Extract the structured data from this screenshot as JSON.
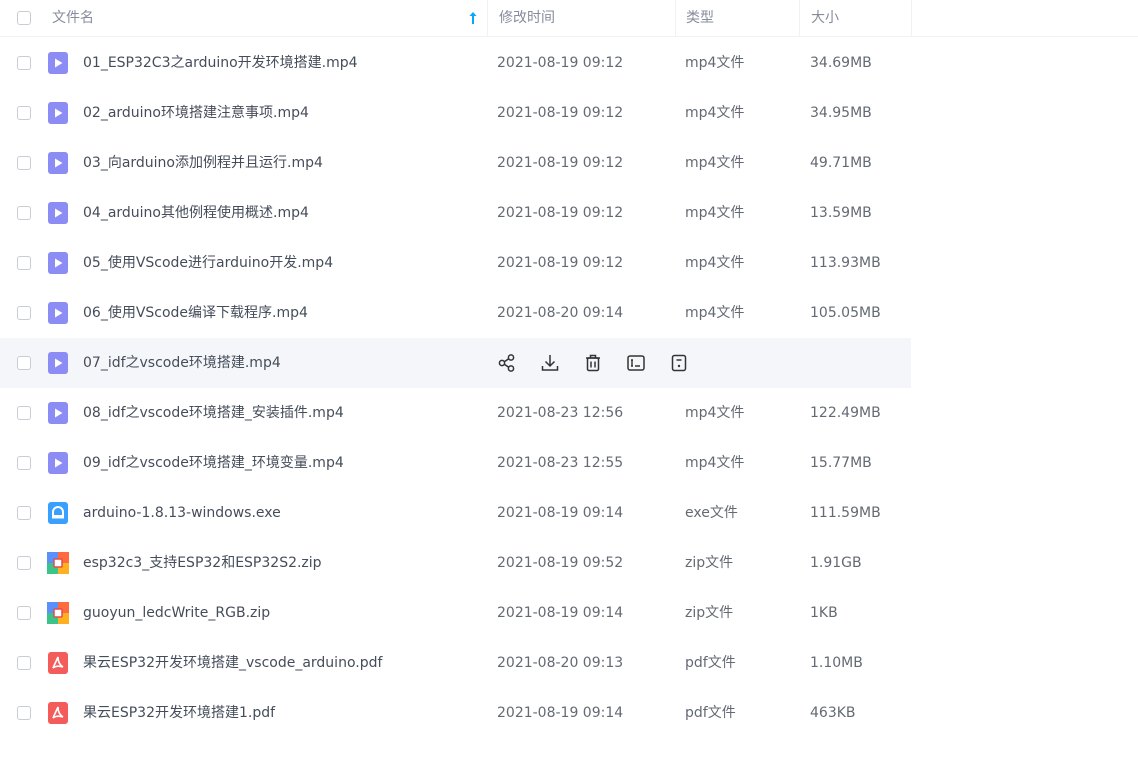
{
  "header": {
    "name_label": "文件名",
    "time_label": "修改时间",
    "type_label": "类型",
    "size_label": "大小",
    "sort": "ascending"
  },
  "colors": {
    "accent": "#06a7ff",
    "video_icon": "#8c8cf5",
    "exe_icon": "#3aa0ff",
    "pdf_icon": "#f45b5b",
    "hover_row": "#f5f6fa"
  },
  "files": [
    {
      "name": "01_ESP32C3之arduino开发环境搭建.mp4",
      "time": "2021-08-19 09:12",
      "type": "mp4文件",
      "size": "34.69MB",
      "icon": "video-file-icon"
    },
    {
      "name": "02_arduino环境搭建注意事项.mp4",
      "time": "2021-08-19 09:12",
      "type": "mp4文件",
      "size": "34.95MB",
      "icon": "video-file-icon"
    },
    {
      "name": "03_向arduino添加例程并且运行.mp4",
      "time": "2021-08-19 09:12",
      "type": "mp4文件",
      "size": "49.71MB",
      "icon": "video-file-icon"
    },
    {
      "name": "04_arduino其他例程使用概述.mp4",
      "time": "2021-08-19 09:12",
      "type": "mp4文件",
      "size": "13.59MB",
      "icon": "video-file-icon"
    },
    {
      "name": "05_使用VScode进行arduino开发.mp4",
      "time": "2021-08-19 09:12",
      "type": "mp4文件",
      "size": "113.93MB",
      "icon": "video-file-icon"
    },
    {
      "name": "06_使用VScode编译下载程序.mp4",
      "time": "2021-08-20 09:14",
      "type": "mp4文件",
      "size": "105.05MB",
      "icon": "video-file-icon"
    },
    {
      "name": "07_idf之vscode环境搭建.mp4",
      "time": "",
      "type": "",
      "size": "",
      "icon": "video-file-icon",
      "hovered": true
    },
    {
      "name": "08_idf之vscode环境搭建_安装插件.mp4",
      "time": "2021-08-23 12:56",
      "type": "mp4文件",
      "size": "122.49MB",
      "icon": "video-file-icon"
    },
    {
      "name": "09_idf之vscode环境搭建_环境变量.mp4",
      "time": "2021-08-23 12:55",
      "type": "mp4文件",
      "size": "15.77MB",
      "icon": "video-file-icon"
    },
    {
      "name": "arduino-1.8.13-windows.exe",
      "time": "2021-08-19 09:14",
      "type": "exe文件",
      "size": "111.59MB",
      "icon": "exe-file-icon"
    },
    {
      "name": "esp32c3_支持ESP32和ESP32S2.zip",
      "time": "2021-08-19 09:52",
      "type": "zip文件",
      "size": "1.91GB",
      "icon": "zip-file-icon"
    },
    {
      "name": "guoyun_ledcWrite_RGB.zip",
      "time": "2021-08-19 09:14",
      "type": "zip文件",
      "size": "1KB",
      "icon": "zip-file-icon"
    },
    {
      "name": "果云ESP32开发环境搭建_vscode_arduino.pdf",
      "time": "2021-08-20 09:13",
      "type": "pdf文件",
      "size": "1.10MB",
      "icon": "pdf-file-icon"
    },
    {
      "name": "果云ESP32开发环境搭建1.pdf",
      "time": "2021-08-19 09:14",
      "type": "pdf文件",
      "size": "463KB",
      "icon": "pdf-file-icon"
    }
  ],
  "hover_actions": [
    "share-icon",
    "download-icon",
    "delete-icon",
    "rename-icon",
    "more-icon"
  ]
}
